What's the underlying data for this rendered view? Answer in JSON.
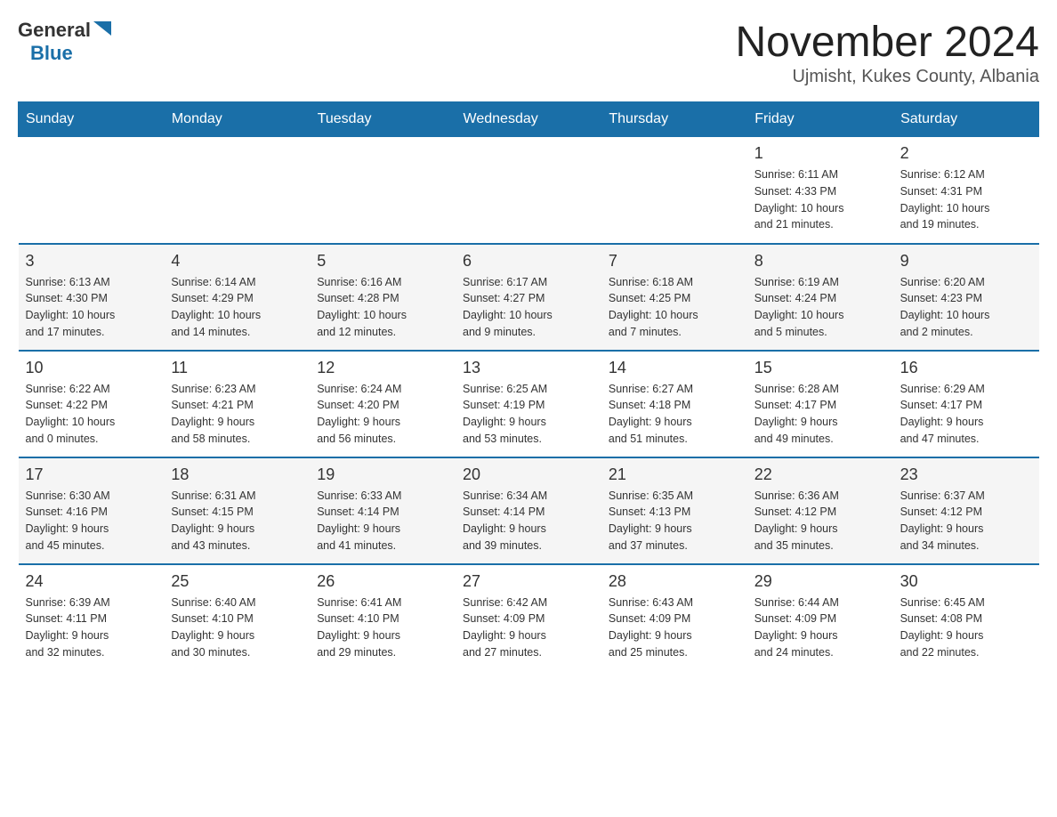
{
  "header": {
    "logo_general": "General",
    "logo_blue": "Blue",
    "month_title": "November 2024",
    "location": "Ujmisht, Kukes County, Albania"
  },
  "days_of_week": [
    "Sunday",
    "Monday",
    "Tuesday",
    "Wednesday",
    "Thursday",
    "Friday",
    "Saturday"
  ],
  "weeks": [
    [
      {
        "day": "",
        "info": ""
      },
      {
        "day": "",
        "info": ""
      },
      {
        "day": "",
        "info": ""
      },
      {
        "day": "",
        "info": ""
      },
      {
        "day": "",
        "info": ""
      },
      {
        "day": "1",
        "info": "Sunrise: 6:11 AM\nSunset: 4:33 PM\nDaylight: 10 hours\nand 21 minutes."
      },
      {
        "day": "2",
        "info": "Sunrise: 6:12 AM\nSunset: 4:31 PM\nDaylight: 10 hours\nand 19 minutes."
      }
    ],
    [
      {
        "day": "3",
        "info": "Sunrise: 6:13 AM\nSunset: 4:30 PM\nDaylight: 10 hours\nand 17 minutes."
      },
      {
        "day": "4",
        "info": "Sunrise: 6:14 AM\nSunset: 4:29 PM\nDaylight: 10 hours\nand 14 minutes."
      },
      {
        "day": "5",
        "info": "Sunrise: 6:16 AM\nSunset: 4:28 PM\nDaylight: 10 hours\nand 12 minutes."
      },
      {
        "day": "6",
        "info": "Sunrise: 6:17 AM\nSunset: 4:27 PM\nDaylight: 10 hours\nand 9 minutes."
      },
      {
        "day": "7",
        "info": "Sunrise: 6:18 AM\nSunset: 4:25 PM\nDaylight: 10 hours\nand 7 minutes."
      },
      {
        "day": "8",
        "info": "Sunrise: 6:19 AM\nSunset: 4:24 PM\nDaylight: 10 hours\nand 5 minutes."
      },
      {
        "day": "9",
        "info": "Sunrise: 6:20 AM\nSunset: 4:23 PM\nDaylight: 10 hours\nand 2 minutes."
      }
    ],
    [
      {
        "day": "10",
        "info": "Sunrise: 6:22 AM\nSunset: 4:22 PM\nDaylight: 10 hours\nand 0 minutes."
      },
      {
        "day": "11",
        "info": "Sunrise: 6:23 AM\nSunset: 4:21 PM\nDaylight: 9 hours\nand 58 minutes."
      },
      {
        "day": "12",
        "info": "Sunrise: 6:24 AM\nSunset: 4:20 PM\nDaylight: 9 hours\nand 56 minutes."
      },
      {
        "day": "13",
        "info": "Sunrise: 6:25 AM\nSunset: 4:19 PM\nDaylight: 9 hours\nand 53 minutes."
      },
      {
        "day": "14",
        "info": "Sunrise: 6:27 AM\nSunset: 4:18 PM\nDaylight: 9 hours\nand 51 minutes."
      },
      {
        "day": "15",
        "info": "Sunrise: 6:28 AM\nSunset: 4:17 PM\nDaylight: 9 hours\nand 49 minutes."
      },
      {
        "day": "16",
        "info": "Sunrise: 6:29 AM\nSunset: 4:17 PM\nDaylight: 9 hours\nand 47 minutes."
      }
    ],
    [
      {
        "day": "17",
        "info": "Sunrise: 6:30 AM\nSunset: 4:16 PM\nDaylight: 9 hours\nand 45 minutes."
      },
      {
        "day": "18",
        "info": "Sunrise: 6:31 AM\nSunset: 4:15 PM\nDaylight: 9 hours\nand 43 minutes."
      },
      {
        "day": "19",
        "info": "Sunrise: 6:33 AM\nSunset: 4:14 PM\nDaylight: 9 hours\nand 41 minutes."
      },
      {
        "day": "20",
        "info": "Sunrise: 6:34 AM\nSunset: 4:14 PM\nDaylight: 9 hours\nand 39 minutes."
      },
      {
        "day": "21",
        "info": "Sunrise: 6:35 AM\nSunset: 4:13 PM\nDaylight: 9 hours\nand 37 minutes."
      },
      {
        "day": "22",
        "info": "Sunrise: 6:36 AM\nSunset: 4:12 PM\nDaylight: 9 hours\nand 35 minutes."
      },
      {
        "day": "23",
        "info": "Sunrise: 6:37 AM\nSunset: 4:12 PM\nDaylight: 9 hours\nand 34 minutes."
      }
    ],
    [
      {
        "day": "24",
        "info": "Sunrise: 6:39 AM\nSunset: 4:11 PM\nDaylight: 9 hours\nand 32 minutes."
      },
      {
        "day": "25",
        "info": "Sunrise: 6:40 AM\nSunset: 4:10 PM\nDaylight: 9 hours\nand 30 minutes."
      },
      {
        "day": "26",
        "info": "Sunrise: 6:41 AM\nSunset: 4:10 PM\nDaylight: 9 hours\nand 29 minutes."
      },
      {
        "day": "27",
        "info": "Sunrise: 6:42 AM\nSunset: 4:09 PM\nDaylight: 9 hours\nand 27 minutes."
      },
      {
        "day": "28",
        "info": "Sunrise: 6:43 AM\nSunset: 4:09 PM\nDaylight: 9 hours\nand 25 minutes."
      },
      {
        "day": "29",
        "info": "Sunrise: 6:44 AM\nSunset: 4:09 PM\nDaylight: 9 hours\nand 24 minutes."
      },
      {
        "day": "30",
        "info": "Sunrise: 6:45 AM\nSunset: 4:08 PM\nDaylight: 9 hours\nand 22 minutes."
      }
    ]
  ]
}
